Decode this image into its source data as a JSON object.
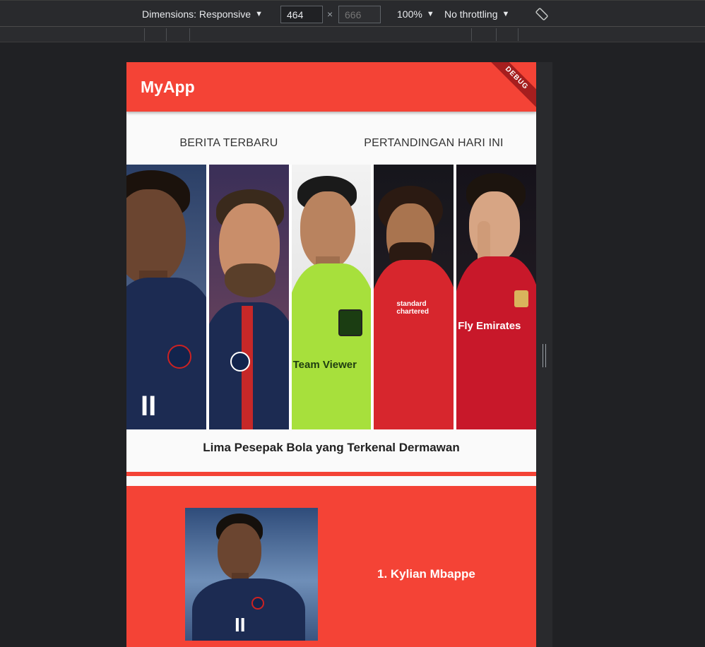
{
  "devtools": {
    "dimensions_label": "Dimensions: Responsive",
    "width_value": "464",
    "height_placeholder": "666",
    "times_symbol": "×",
    "zoom_label": "100%",
    "throttle_label": "No throttling",
    "caret": "▼"
  },
  "app": {
    "title": "MyApp",
    "debug_label": "DEBUG",
    "accent_color": "#f44336"
  },
  "tabs": [
    {
      "label": "BERITA TERBARU"
    },
    {
      "label": "PERTANDINGAN HARI INI"
    }
  ],
  "hero": {
    "caption": "Lima Pesepak Bola yang Terkenal Dermawan",
    "sponsors": [
      "Team Viewer",
      "standard chartered",
      "Fly Emirates"
    ]
  },
  "players": [
    {
      "name": "1. Kylian Mbappe"
    }
  ]
}
